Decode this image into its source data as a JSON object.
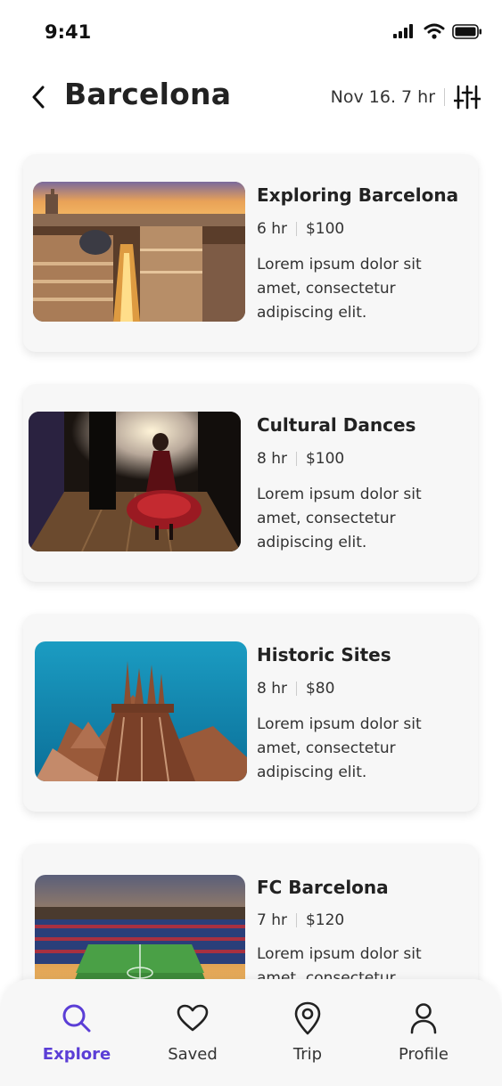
{
  "status_bar": {
    "time": "9:41"
  },
  "header": {
    "title": "Barcelona",
    "date_info": "Nov 16. 7 hr"
  },
  "tours": [
    {
      "title": "Exploring Barcelona",
      "duration": "6 hr",
      "price": "$100",
      "description": "Lorem ipsum dolor sit amet, consectetur adipiscing elit."
    },
    {
      "title": "Cultural Dances",
      "duration": "8 hr",
      "price": "$100",
      "description": "Lorem ipsum dolor sit amet, consectetur adipiscing elit."
    },
    {
      "title": "Historic Sites",
      "duration": "8 hr",
      "price": "$80",
      "description": "Lorem ipsum dolor sit amet, consectetur adipiscing elit."
    },
    {
      "title": "FC Barcelona",
      "duration": "7 hr",
      "price": "$120",
      "description": "Lorem ipsum dolor sit amet, consectetur adipiscing elit."
    }
  ],
  "tab_bar": {
    "tabs": [
      {
        "label": "Explore",
        "icon": "search-icon",
        "active": true
      },
      {
        "label": "Saved",
        "icon": "heart-icon",
        "active": false
      },
      {
        "label": "Trip",
        "icon": "map-pin-icon",
        "active": false
      },
      {
        "label": "Profile",
        "icon": "user-icon",
        "active": false
      }
    ]
  },
  "colors": {
    "accent": "#5b3ed6",
    "card_bg": "#f7f7f7",
    "text": "#222222"
  }
}
